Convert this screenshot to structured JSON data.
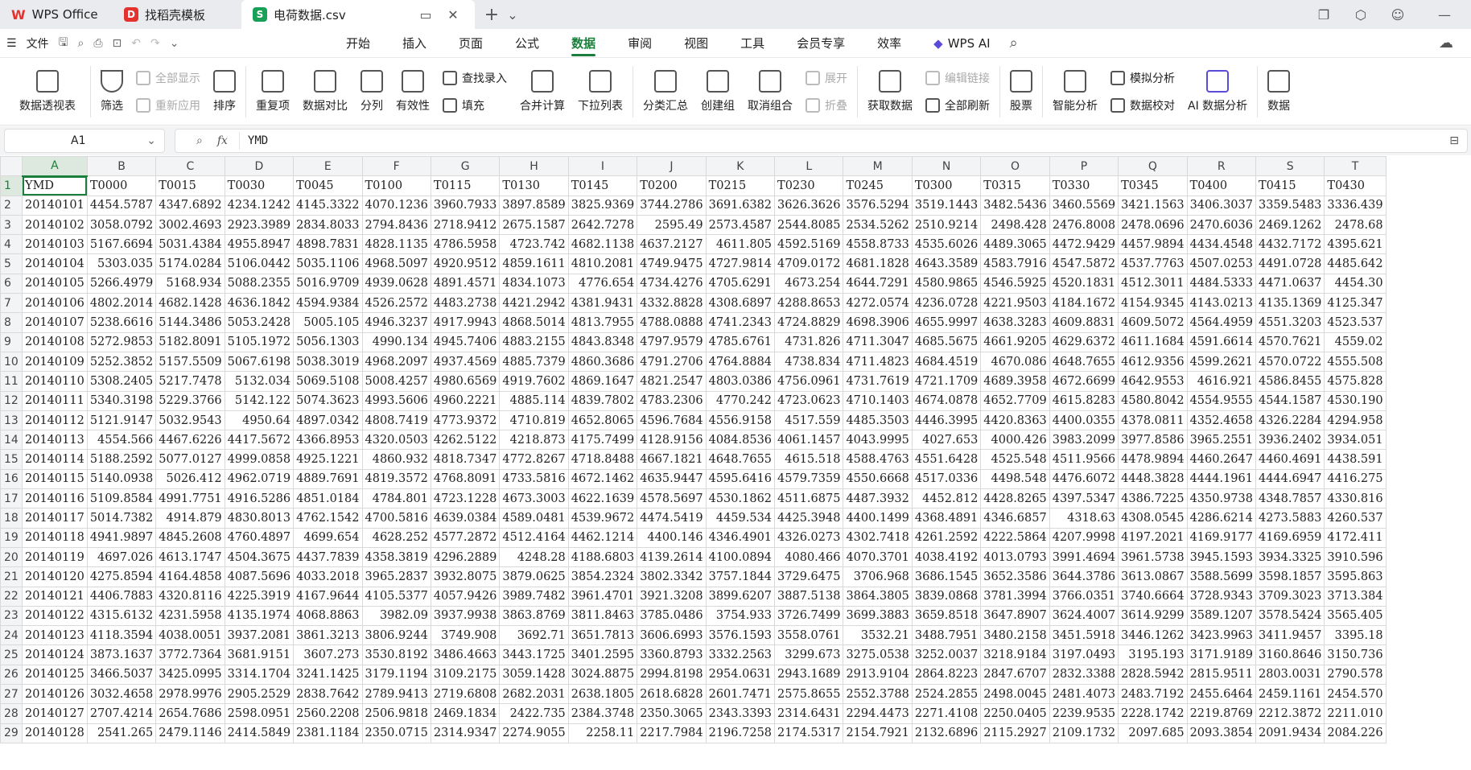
{
  "titlebar": {
    "home_tab": "WPS Office",
    "template_tab": "找稻壳模板",
    "file_tab": "电荷数据.csv",
    "file_badge": "S"
  },
  "menubar": {
    "file_label": "文件",
    "items": [
      "开始",
      "插入",
      "页面",
      "公式",
      "数据",
      "审阅",
      "视图",
      "工具",
      "会员专享",
      "效率"
    ],
    "active": "数据",
    "ai_label": "WPS AI"
  },
  "ribbon": {
    "pivot": "数据透视表",
    "filter": "筛选",
    "show_all": "全部显示",
    "reapply": "重新应用",
    "sort": "排序",
    "duplicates": "重复项",
    "compare": "数据对比",
    "split": "分列",
    "validity": "有效性",
    "find_entry": "查找录入",
    "fill": "填充",
    "consolidate": "合并计算",
    "dropdown_list": "下拉列表",
    "subtotal": "分类汇总",
    "group": "创建组",
    "ungroup": "取消组合",
    "expand": "展开",
    "collapse": "折叠",
    "get_data": "获取数据",
    "edit_links": "编辑链接",
    "refresh_all": "全部刷新",
    "stocks": "股票",
    "smart_analysis": "智能分析",
    "what_if": "模拟分析",
    "data_check": "数据校对",
    "ai_analysis": "AI 数据分析",
    "more": "数据"
  },
  "formula_bar": {
    "cell_ref": "A1",
    "fx": "fx",
    "content": "YMD"
  },
  "grid": {
    "columns": [
      "A",
      "B",
      "C",
      "D",
      "E",
      "F",
      "G",
      "H",
      "I",
      "J",
      "K",
      "L",
      "M",
      "N",
      "O",
      "P",
      "Q",
      "R",
      "S",
      "T"
    ],
    "header_row": [
      "YMD",
      "T0000",
      "T0015",
      "T0030",
      "T0045",
      "T0100",
      "T0115",
      "T0130",
      "T0145",
      "T0200",
      "T0215",
      "T0230",
      "T0245",
      "T0300",
      "T0315",
      "T0330",
      "T0345",
      "T0400",
      "T0415",
      "T0430"
    ],
    "rows": [
      [
        "20140101",
        "4454.5787",
        "4347.6892",
        "4234.1242",
        "4145.3322",
        "4070.1236",
        "3960.7933",
        "3897.8589",
        "3825.9369",
        "3744.2786",
        "3691.6382",
        "3626.3626",
        "3576.5294",
        "3519.1443",
        "3482.5436",
        "3460.5569",
        "3421.1563",
        "3406.3037",
        "3359.5483",
        "3336.439"
      ],
      [
        "20140102",
        "3058.0792",
        "3002.4693",
        "2923.3989",
        "2834.8033",
        "2794.8436",
        "2718.9412",
        "2675.1587",
        "2642.7278",
        "2595.49",
        "2573.4587",
        "2544.8085",
        "2534.5262",
        "2510.9214",
        "2498.428",
        "2476.8008",
        "2478.0696",
        "2470.6036",
        "2469.1262",
        "2478.68"
      ],
      [
        "20140103",
        "5167.6694",
        "5031.4384",
        "4955.8947",
        "4898.7831",
        "4828.1135",
        "4786.5958",
        "4723.742",
        "4682.1138",
        "4637.2127",
        "4611.805",
        "4592.5169",
        "4558.8733",
        "4535.6026",
        "4489.3065",
        "4472.9429",
        "4457.9894",
        "4434.4548",
        "4432.7172",
        "4395.621"
      ],
      [
        "20140104",
        "5303.035",
        "5174.0284",
        "5106.0442",
        "5035.1106",
        "4968.5097",
        "4920.9512",
        "4859.1611",
        "4810.2081",
        "4749.9475",
        "4727.9814",
        "4709.0172",
        "4681.1828",
        "4643.3589",
        "4583.7916",
        "4547.5872",
        "4537.7763",
        "4507.0253",
        "4491.0728",
        "4485.642"
      ],
      [
        "20140105",
        "5266.4979",
        "5168.934",
        "5088.2355",
        "5016.9709",
        "4939.0628",
        "4891.4571",
        "4834.1073",
        "4776.654",
        "4734.4276",
        "4705.6291",
        "4673.254",
        "4644.7291",
        "4580.9865",
        "4546.5925",
        "4520.1831",
        "4512.3011",
        "4484.5333",
        "4471.0637",
        "4454.30"
      ],
      [
        "20140106",
        "4802.2014",
        "4682.1428",
        "4636.1842",
        "4594.9384",
        "4526.2572",
        "4483.2738",
        "4421.2942",
        "4381.9431",
        "4332.8828",
        "4308.6897",
        "4288.8653",
        "4272.0574",
        "4236.0728",
        "4221.9503",
        "4184.1672",
        "4154.9345",
        "4143.0213",
        "4135.1369",
        "4125.347"
      ],
      [
        "20140107",
        "5238.6616",
        "5144.3486",
        "5053.2428",
        "5005.105",
        "4946.3237",
        "4917.9943",
        "4868.5014",
        "4813.7955",
        "4788.0888",
        "4741.2343",
        "4724.8829",
        "4698.3906",
        "4655.9997",
        "4638.3283",
        "4609.8831",
        "4609.5072",
        "4564.4959",
        "4551.3203",
        "4523.537"
      ],
      [
        "20140108",
        "5272.9853",
        "5182.8091",
        "5105.1972",
        "5056.1303",
        "4990.134",
        "4945.7406",
        "4883.2155",
        "4843.8348",
        "4797.9579",
        "4785.6761",
        "4731.826",
        "4711.3047",
        "4685.5675",
        "4661.9205",
        "4629.6372",
        "4611.1684",
        "4591.6614",
        "4570.7621",
        "4559.02"
      ],
      [
        "20140109",
        "5252.3852",
        "5157.5509",
        "5067.6198",
        "5038.3019",
        "4968.2097",
        "4937.4569",
        "4885.7379",
        "4860.3686",
        "4791.2706",
        "4764.8884",
        "4738.834",
        "4711.4823",
        "4684.4519",
        "4670.086",
        "4648.7655",
        "4612.9356",
        "4599.2621",
        "4570.0722",
        "4555.508"
      ],
      [
        "20140110",
        "5308.2405",
        "5217.7478",
        "5132.034",
        "5069.5108",
        "5008.4257",
        "4980.6569",
        "4919.7602",
        "4869.1647",
        "4821.2547",
        "4803.0386",
        "4756.0961",
        "4731.7619",
        "4721.1709",
        "4689.3958",
        "4672.6699",
        "4642.9553",
        "4616.921",
        "4586.8455",
        "4575.828"
      ],
      [
        "20140111",
        "5340.3198",
        "5229.3766",
        "5142.122",
        "5074.3623",
        "4993.5606",
        "4960.2221",
        "4885.114",
        "4839.7802",
        "4783.2306",
        "4770.242",
        "4723.0623",
        "4710.1403",
        "4674.0878",
        "4652.7709",
        "4615.8283",
        "4580.8042",
        "4554.9555",
        "4544.1587",
        "4530.190"
      ],
      [
        "20140112",
        "5121.9147",
        "5032.9543",
        "4950.64",
        "4897.0342",
        "4808.7419",
        "4773.9372",
        "4710.819",
        "4652.8065",
        "4596.7684",
        "4556.9158",
        "4517.559",
        "4485.3503",
        "4446.3995",
        "4420.8363",
        "4400.0355",
        "4378.0811",
        "4352.4658",
        "4326.2284",
        "4294.958"
      ],
      [
        "20140113",
        "4554.566",
        "4467.6226",
        "4417.5672",
        "4366.8953",
        "4320.0503",
        "4262.5122",
        "4218.873",
        "4175.7499",
        "4128.9156",
        "4084.8536",
        "4061.1457",
        "4043.9995",
        "4027.653",
        "4000.426",
        "3983.2099",
        "3977.8586",
        "3965.2551",
        "3936.2402",
        "3934.051"
      ],
      [
        "20140114",
        "5188.2592",
        "5077.0127",
        "4999.0858",
        "4925.1221",
        "4860.932",
        "4818.7347",
        "4772.8267",
        "4718.8488",
        "4667.1821",
        "4648.7655",
        "4615.518",
        "4588.4763",
        "4551.6428",
        "4525.548",
        "4511.9566",
        "4478.9894",
        "4460.2647",
        "4460.4691",
        "4438.591"
      ],
      [
        "20140115",
        "5140.0938",
        "5026.412",
        "4962.0719",
        "4889.7691",
        "4819.3572",
        "4768.8091",
        "4733.5816",
        "4672.1462",
        "4635.9447",
        "4595.6416",
        "4579.7359",
        "4550.6668",
        "4517.0336",
        "4498.548",
        "4476.6072",
        "4448.3828",
        "4444.1961",
        "4444.6947",
        "4416.275"
      ],
      [
        "20140116",
        "5109.8584",
        "4991.7751",
        "4916.5286",
        "4851.0184",
        "4784.801",
        "4723.1228",
        "4673.3003",
        "4622.1639",
        "4578.5697",
        "4530.1862",
        "4511.6875",
        "4487.3932",
        "4452.812",
        "4428.8265",
        "4397.5347",
        "4386.7225",
        "4350.9738",
        "4348.7857",
        "4330.816"
      ],
      [
        "20140117",
        "5014.7382",
        "4914.879",
        "4830.8013",
        "4762.1542",
        "4700.5816",
        "4639.0384",
        "4589.0481",
        "4539.9672",
        "4474.5419",
        "4459.534",
        "4425.3948",
        "4400.1499",
        "4368.4891",
        "4346.6857",
        "4318.63",
        "4308.0545",
        "4286.6214",
        "4273.5883",
        "4260.537"
      ],
      [
        "20140118",
        "4941.9897",
        "4845.2608",
        "4760.4897",
        "4699.654",
        "4628.252",
        "4577.2872",
        "4512.4164",
        "4462.1214",
        "4400.146",
        "4346.4901",
        "4326.0273",
        "4302.7418",
        "4261.2592",
        "4222.5864",
        "4207.9998",
        "4197.2021",
        "4169.9177",
        "4169.6959",
        "4172.411"
      ],
      [
        "20140119",
        "4697.026",
        "4613.1747",
        "4504.3675",
        "4437.7839",
        "4358.3819",
        "4296.2889",
        "4248.28",
        "4188.6803",
        "4139.2614",
        "4100.0894",
        "4080.466",
        "4070.3701",
        "4038.4192",
        "4013.0793",
        "3991.4694",
        "3961.5738",
        "3945.1593",
        "3934.3325",
        "3910.596"
      ],
      [
        "20140120",
        "4275.8594",
        "4164.4858",
        "4087.5696",
        "4033.2018",
        "3965.2837",
        "3932.8075",
        "3879.0625",
        "3854.2324",
        "3802.3342",
        "3757.1844",
        "3729.6475",
        "3706.968",
        "3686.1545",
        "3652.3586",
        "3644.3786",
        "3613.0867",
        "3588.5699",
        "3598.1857",
        "3595.863"
      ],
      [
        "20140121",
        "4406.7883",
        "4320.8116",
        "4225.3919",
        "4167.9644",
        "4105.5377",
        "4057.9426",
        "3989.7482",
        "3961.4701",
        "3921.3208",
        "3899.6207",
        "3887.5138",
        "3864.3805",
        "3839.0868",
        "3781.3994",
        "3766.0351",
        "3740.6664",
        "3728.9343",
        "3709.3023",
        "3713.384"
      ],
      [
        "20140122",
        "4315.6132",
        "4231.5958",
        "4135.1974",
        "4068.8863",
        "3982.09",
        "3937.9938",
        "3863.8769",
        "3811.8463",
        "3785.0486",
        "3754.933",
        "3726.7499",
        "3699.3883",
        "3659.8518",
        "3647.8907",
        "3624.4007",
        "3614.9299",
        "3589.1207",
        "3578.5424",
        "3565.405"
      ],
      [
        "20140123",
        "4118.3594",
        "4038.0051",
        "3937.2081",
        "3861.3213",
        "3806.9244",
        "3749.908",
        "3692.71",
        "3651.7813",
        "3606.6993",
        "3576.1593",
        "3558.0761",
        "3532.21",
        "3488.7951",
        "3480.2158",
        "3451.5918",
        "3446.1262",
        "3423.9963",
        "3411.9457",
        "3395.18"
      ],
      [
        "20140124",
        "3873.1637",
        "3772.7364",
        "3681.9151",
        "3607.273",
        "3530.8192",
        "3486.4663",
        "3443.1725",
        "3401.2595",
        "3360.8793",
        "3332.2563",
        "3299.673",
        "3275.0538",
        "3252.0037",
        "3218.9184",
        "3197.0493",
        "3195.193",
        "3171.9189",
        "3160.8646",
        "3150.736"
      ],
      [
        "20140125",
        "3466.5037",
        "3425.0995",
        "3314.1704",
        "3241.1425",
        "3179.1194",
        "3109.2175",
        "3059.1428",
        "3024.8875",
        "2994.8198",
        "2954.0631",
        "2943.1689",
        "2913.9104",
        "2864.8223",
        "2847.6707",
        "2832.3388",
        "2828.5942",
        "2815.9511",
        "2803.0031",
        "2790.578"
      ],
      [
        "20140126",
        "3032.4658",
        "2978.9976",
        "2905.2529",
        "2838.7642",
        "2789.9413",
        "2719.6808",
        "2682.2031",
        "2638.1805",
        "2618.6828",
        "2601.7471",
        "2575.8655",
        "2552.3788",
        "2524.2855",
        "2498.0045",
        "2481.4073",
        "2483.7192",
        "2455.6464",
        "2459.1161",
        "2454.570"
      ],
      [
        "20140127",
        "2707.4214",
        "2654.7686",
        "2598.0951",
        "2560.2208",
        "2506.9818",
        "2469.1834",
        "2422.735",
        "2384.3748",
        "2350.3065",
        "2343.3393",
        "2314.6431",
        "2294.4473",
        "2271.4108",
        "2250.0405",
        "2239.9535",
        "2228.1742",
        "2219.8769",
        "2212.3872",
        "2211.010"
      ],
      [
        "20140128",
        "2541.265",
        "2479.1146",
        "2414.5849",
        "2381.1184",
        "2350.0715",
        "2314.9347",
        "2274.9055",
        "2258.11",
        "2217.7984",
        "2196.7258",
        "2174.5317",
        "2154.7921",
        "2132.6896",
        "2115.2927",
        "2109.1732",
        "2097.685",
        "2093.3854",
        "2091.9434",
        "2084.226"
      ]
    ]
  },
  "colors": {
    "accent": "#1a7f3b",
    "titlebar_bg": "#e9ebee",
    "wps_red": "#e4332f",
    "csv_badge": "#18a058"
  }
}
